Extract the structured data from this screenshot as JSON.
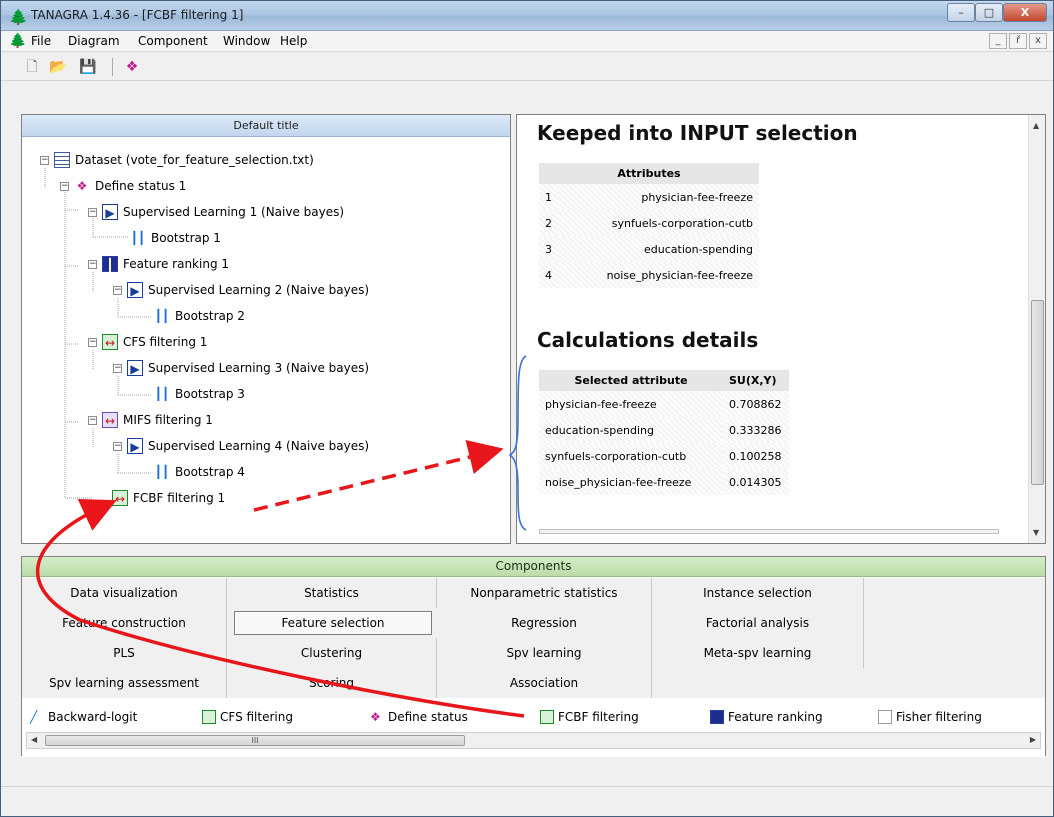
{
  "window": {
    "title": "TANAGRA 1.4.36 - [FCBF filtering 1]",
    "min": "–",
    "max": "□",
    "close": "X"
  },
  "menu": {
    "items": [
      "File",
      "Diagram",
      "Component",
      "Window",
      "Help"
    ],
    "mdi": [
      "_",
      "ř",
      "x"
    ]
  },
  "toolbar": {
    "icons": [
      "new-file-icon",
      "open-folder-icon",
      "save-disk-icon",
      "define-status-icon"
    ]
  },
  "diagram": {
    "header": "Default title",
    "nodes": [
      {
        "label": "Dataset (vote_for_feature_selection.txt)",
        "icon": "dataset-icon"
      },
      {
        "label": "Define status 1",
        "icon": "define-status-icon"
      },
      {
        "label": "Supervised Learning 1 (Naive bayes)",
        "icon": "supervised-learning-icon"
      },
      {
        "label": "Bootstrap 1",
        "icon": "bootstrap-icon"
      },
      {
        "label": "Feature ranking 1",
        "icon": "feature-ranking-icon"
      },
      {
        "label": "Supervised Learning 2 (Naive bayes)",
        "icon": "supervised-learning-icon"
      },
      {
        "label": "Bootstrap 2",
        "icon": "bootstrap-icon"
      },
      {
        "label": "CFS filtering 1",
        "icon": "cfs-filtering-icon"
      },
      {
        "label": "Supervised Learning 3 (Naive bayes)",
        "icon": "supervised-learning-icon"
      },
      {
        "label": "Bootstrap 3",
        "icon": "bootstrap-icon"
      },
      {
        "label": "MIFS filtering 1",
        "icon": "mifs-filtering-icon"
      },
      {
        "label": "Supervised Learning 4 (Naive bayes)",
        "icon": "supervised-learning-icon"
      },
      {
        "label": "Bootstrap 4",
        "icon": "bootstrap-icon"
      },
      {
        "label": "FCBF filtering 1",
        "icon": "fcbf-filtering-icon"
      }
    ]
  },
  "results": {
    "keeped_title": "Keeped into INPUT selection",
    "attributes_header": "Attributes",
    "attributes": [
      {
        "index": "1",
        "name": "physician-fee-freeze"
      },
      {
        "index": "2",
        "name": "synfuels-corporation-cutb"
      },
      {
        "index": "3",
        "name": "education-spending"
      },
      {
        "index": "4",
        "name": "noise_physician-fee-freeze"
      }
    ],
    "details_title": "Calculations details",
    "details_header": [
      "Selected attribute",
      "SU(X,Y)"
    ],
    "details": [
      {
        "attribute": "physician-fee-freeze",
        "su": "0.708862"
      },
      {
        "attribute": "education-spending",
        "su": "0.333286"
      },
      {
        "attribute": "synfuels-corporation-cutb",
        "su": "0.100258"
      },
      {
        "attribute": "noise_physician-fee-freeze",
        "su": "0.014305"
      }
    ]
  },
  "components": {
    "header": "Components",
    "categories": [
      "Data visualization",
      "Statistics",
      "Nonparametric statistics",
      "Instance selection",
      "Feature construction",
      "Feature selection",
      "Regression",
      "Factorial analysis",
      "PLS",
      "Clustering",
      "Spv learning",
      "Meta-spv learning",
      "Spv learning assessment",
      "Scoring",
      "Association"
    ],
    "selected": "Feature selection",
    "items": [
      {
        "label": "Backward-logit",
        "icon": "backward-logit-icon"
      },
      {
        "label": "CFS filtering",
        "icon": "cfs-filtering-icon"
      },
      {
        "label": "Define status",
        "icon": "define-status-icon"
      },
      {
        "label": "FCBF filtering",
        "icon": "fcbf-filtering-icon"
      },
      {
        "label": "Feature ranking",
        "icon": "feature-ranking-icon"
      },
      {
        "label": "Fisher filtering",
        "icon": "fisher-filtering-icon"
      }
    ],
    "scroll_grip": "III"
  },
  "colors": {
    "annotation_arrow": "#e8161b",
    "brace": "#3a6fd8",
    "components_header": "#c7e2b6",
    "diagram_header": "#cfe0f4"
  }
}
